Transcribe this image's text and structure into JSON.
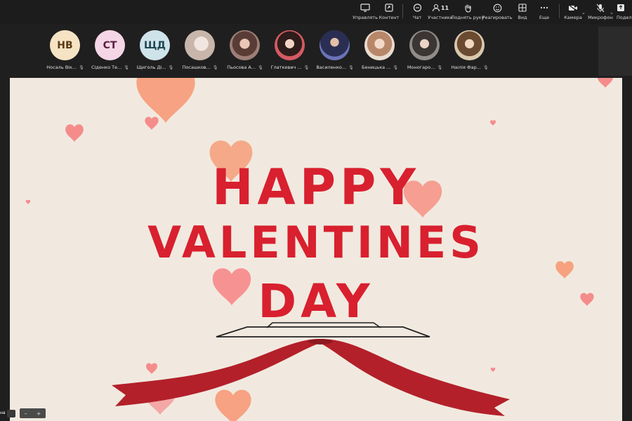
{
  "toolbar": {
    "manage_label": "Управлять",
    "content_label": "Контент",
    "chat_label": "Чат",
    "participants_label": "Участники",
    "participants_count": "11",
    "raise_hand_label": "Поднять руку",
    "react_label": "Реагировать",
    "view_label": "Вид",
    "more_label": "Еще",
    "camera_label": "Камера",
    "mic_label": "Микрофон",
    "share_label": "Подел"
  },
  "participants": [
    {
      "initials": "НВ",
      "name": "Носаль Вік...",
      "color": "#f6e3c4",
      "text_color": "#5a3a12"
    },
    {
      "initials": "СТ",
      "name": "Сіденко Те...",
      "color": "#f5d6e6",
      "text_color": "#5a1e3e"
    },
    {
      "initials": "ЩД",
      "name": "Щиголь Ді...",
      "color": "#cfe3ea",
      "text_color": "#1f4653"
    },
    {
      "initials": "",
      "name": "Посашков...",
      "color": "#d9cfc7",
      "text_color": "#333"
    },
    {
      "initials": "",
      "name": "Пьосова А...",
      "color": "#b08f86",
      "text_color": "#333"
    },
    {
      "initials": "",
      "name": "Глаткевич ...",
      "color": "#6f4d4a",
      "text_color": "#fff"
    },
    {
      "initials": "",
      "name": "Василенко...",
      "color": "#3e4a7a",
      "text_color": "#fff"
    },
    {
      "initials": "",
      "name": "Беницька ...",
      "color": "#d7b49a",
      "text_color": "#333"
    },
    {
      "initials": "",
      "name": "Моногаро...",
      "color": "#5d5a59",
      "text_color": "#fff"
    },
    {
      "initials": "",
      "name": "Наілія Фар...",
      "color": "#c9b79a",
      "text_color": "#333"
    }
  ],
  "slide": {
    "line1": "HAPPY",
    "line2": "VALENTINES",
    "line3": "DAY"
  },
  "bottom": {
    "label": "на"
  }
}
